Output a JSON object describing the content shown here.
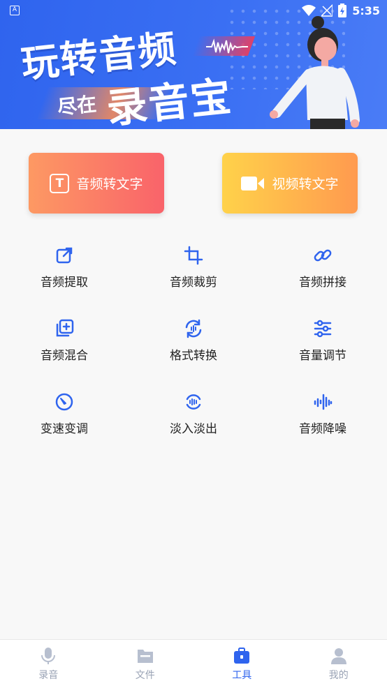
{
  "status_bar": {
    "time": "5:35",
    "app_indicator": "A"
  },
  "banner": {
    "headline": "玩转音频",
    "sub_small": "尽在",
    "sub_big": "录音宝"
  },
  "actions": {
    "audio_to_text": "音频转文字",
    "video_to_text": "视频转文字"
  },
  "tools": [
    {
      "label": "音频提取",
      "icon": "extract-icon"
    },
    {
      "label": "音频裁剪",
      "icon": "crop-icon"
    },
    {
      "label": "音频拼接",
      "icon": "link-icon"
    },
    {
      "label": "音频混合",
      "icon": "mix-icon"
    },
    {
      "label": "格式转换",
      "icon": "convert-icon"
    },
    {
      "label": "音量调节",
      "icon": "sliders-icon"
    },
    {
      "label": "变速变调",
      "icon": "speed-icon"
    },
    {
      "label": "淡入淡出",
      "icon": "fade-icon"
    },
    {
      "label": "音频降噪",
      "icon": "denoise-icon"
    }
  ],
  "nav": [
    {
      "label": "录音",
      "icon": "microphone-icon",
      "active": false
    },
    {
      "label": "文件",
      "icon": "folder-icon",
      "active": false
    },
    {
      "label": "工具",
      "icon": "toolbox-icon",
      "active": true
    },
    {
      "label": "我的",
      "icon": "person-icon",
      "active": false
    }
  ],
  "colors": {
    "accent": "#2f64ee",
    "inactive": "#9aa3b5",
    "audio_btn_start": "#fd9963",
    "audio_btn_end": "#f9636a",
    "video_btn_start": "#ffd24a",
    "video_btn_end": "#ff9a4f"
  }
}
